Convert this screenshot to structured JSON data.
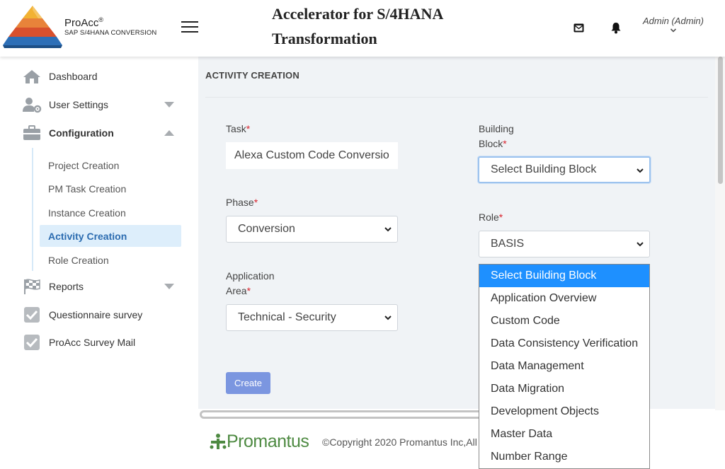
{
  "brand": {
    "name": "ProAcc",
    "registered": "®",
    "subtitle": "SAP S/4HANA CONVERSION"
  },
  "header": {
    "title_line1": "Accelerator for S/4HANA",
    "title_line2": "Transformation",
    "user_label": "Admin (Admin)",
    "icons": [
      "menu-icon",
      "mail-icon",
      "bell-icon",
      "chevron-down-icon"
    ]
  },
  "sidebar": {
    "items": [
      {
        "label": "Dashboard",
        "icon": "home-icon"
      },
      {
        "label": "User Settings",
        "icon": "user-settings-icon"
      },
      {
        "label": "Configuration",
        "icon": "briefcase-icon"
      },
      {
        "label": "Reports",
        "icon": "checkered-flag-icon"
      },
      {
        "label": "Questionnaire survey",
        "icon": "checkbox-icon"
      },
      {
        "label": "ProAcc Survey Mail",
        "icon": "checkbox-icon"
      }
    ],
    "sub_items": [
      {
        "label": "Project Creation"
      },
      {
        "label": "PM Task Creation"
      },
      {
        "label": "Instance Creation"
      },
      {
        "label": "Activity Creation",
        "active": true
      },
      {
        "label": "Role Creation"
      }
    ]
  },
  "main": {
    "heading": "ACTIVITY CREATION",
    "required_mark": "*",
    "task": {
      "label": "Task",
      "value": "Alexa Custom Code Conversio"
    },
    "building_block": {
      "label_line1": "Building",
      "label_line2": "Block",
      "value": "Select Building Block"
    },
    "phase": {
      "label": "Phase",
      "value": "Conversion"
    },
    "role": {
      "label": "Role",
      "value": "BASIS"
    },
    "application_area": {
      "label_line1": "Application",
      "label_line2": "Area",
      "value": "Technical - Security"
    },
    "create_button": "Create"
  },
  "dropdown": {
    "options": [
      "Select Building Block",
      "Application Overview",
      "Custom Code",
      "Data Consistency Verification",
      "Data Management",
      "Data Migration",
      "Development Objects",
      "Master Data",
      "Number Range"
    ],
    "highlighted_index": 0
  },
  "footer": {
    "logo_text": "Promantus",
    "copyright": "©Copyright 2020 Promantus Inc,All"
  },
  "colors": {
    "accent": "#1e90ff",
    "button": "#7b96e0",
    "required": "#d9232d",
    "active_nav_bg": "#ddeefb",
    "main_bg": "#f0f3f6"
  }
}
